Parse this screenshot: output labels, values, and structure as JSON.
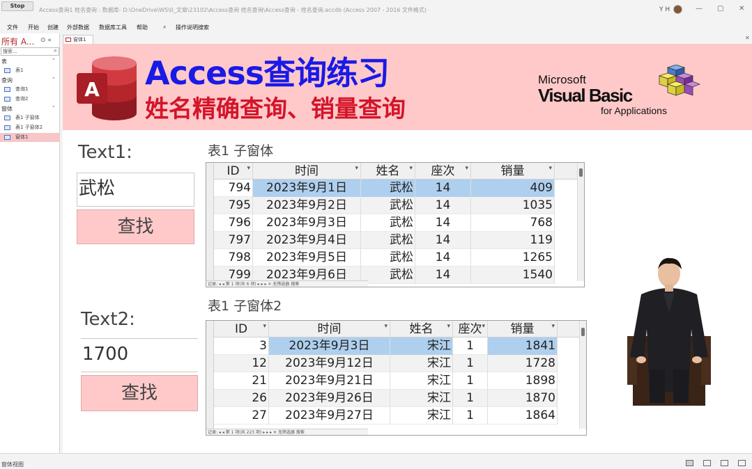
{
  "titlebar": {
    "stop_label": "Stop",
    "title": "Access查询1 姓名查询 : 数据库- D:\\OneDrive\\WS\\0_文章\\23102\\Access查询 姓名查询\\Access查询 - 姓名查询.accdb (Access 2007 - 2016 文件格式) - Access",
    "user_initials": "Y H",
    "minimize": "—",
    "restore": "▢",
    "close": "✕"
  },
  "ribbon": {
    "tabs": [
      "文件",
      "开始",
      "创建",
      "外部数据",
      "数据库工具",
      "帮助"
    ],
    "search_icon": "lightbulb-search-icon",
    "search_label": "操作说明搜索"
  },
  "nav": {
    "header": "所有 A...",
    "search_placeholder": "搜索...",
    "groups": [
      {
        "label": "表",
        "items": [
          {
            "label": "表1",
            "selected": false
          }
        ]
      },
      {
        "label": "查询",
        "items": [
          {
            "label": "查询1",
            "selected": false
          },
          {
            "label": "查询2",
            "selected": false
          }
        ]
      },
      {
        "label": "窗体",
        "items": [
          {
            "label": "表1 子窗体",
            "selected": false
          },
          {
            "label": "表1 子窗体2",
            "selected": false
          },
          {
            "label": "窗体1",
            "selected": true
          }
        ]
      }
    ]
  },
  "doc_tab": {
    "label": "窗体1",
    "close": "✕"
  },
  "banner": {
    "logo_letter": "A",
    "title": "Access查询练习",
    "subtitle": "姓名精确查询、销量查询",
    "vba_line1": "Microsoft",
    "vba_line2": "Visual Basic",
    "vba_line3": "for Applications"
  },
  "text1": {
    "label": "Text1:",
    "value": "武松",
    "button": "查找"
  },
  "text2": {
    "label": "Text2:",
    "value": "1700",
    "button": "查找"
  },
  "sub1": {
    "title": "表1 子窗体",
    "columns": [
      "ID",
      "时间",
      "姓名",
      "座次",
      "销量"
    ],
    "rows": [
      [
        "794",
        "2023年9月1日",
        "武松",
        "14",
        "409"
      ],
      [
        "795",
        "2023年9月2日",
        "武松",
        "14",
        "1035"
      ],
      [
        "796",
        "2023年9月3日",
        "武松",
        "14",
        "768"
      ],
      [
        "797",
        "2023年9月4日",
        "武松",
        "14",
        "119"
      ],
      [
        "798",
        "2023年9月5日",
        "武松",
        "14",
        "1265"
      ],
      [
        "799",
        "2023年9月6日",
        "武松",
        "14",
        "1540"
      ]
    ],
    "record_nav": "记录: ◂ ◂ 第 1 项(共 6 项) ▸ ▸ ▸ ✕ 无筛选器  搜索"
  },
  "sub2": {
    "title": "表1 子窗体2",
    "columns": [
      "ID",
      "时间",
      "姓名",
      "座次",
      "销量"
    ],
    "rows": [
      [
        "3",
        "2023年9月3日",
        "宋江",
        "1",
        "1841"
      ],
      [
        "12",
        "2023年9月12日",
        "宋江",
        "1",
        "1728"
      ],
      [
        "21",
        "2023年9月21日",
        "宋江",
        "1",
        "1898"
      ],
      [
        "26",
        "2023年9月26日",
        "宋江",
        "1",
        "1870"
      ],
      [
        "27",
        "2023年9月27日",
        "宋江",
        "1",
        "1864"
      ]
    ],
    "record_nav": "记录: ◂ ◂ 第 1 项(共 223 项) ▸ ▸ ▸ ✕ 无筛选器  搜索"
  },
  "status": {
    "text": "窗体视图"
  },
  "colors": {
    "banner_bg": "#ffc9c9",
    "title_blue": "#1a1ae6",
    "subtitle_red": "#d4142a",
    "highlight": "#aecfee",
    "button_bg": "#ffc9c9"
  }
}
